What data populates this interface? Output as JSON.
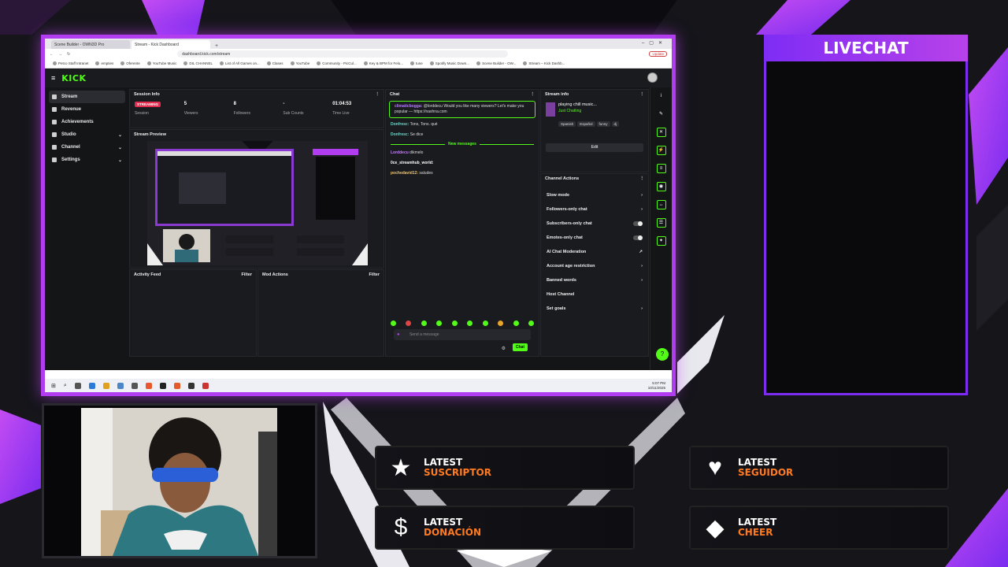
{
  "browser": {
    "tabs": [
      "Scene Builder - OWN3D Pro",
      "Stream - Kick Dashboard"
    ],
    "url": "dashboard.kick.com/stream",
    "update_label": "Update",
    "bookmarks": [
      "Petco Staff Intranet",
      "empties",
      "Oferente",
      "YouTube Music",
      "DIL CHANNEL",
      "List of All Games on...",
      "Clases",
      "YouTube",
      "Community - PicCul...",
      "Key & BPM for Felo...",
      "tune",
      "Spotify Music Down...",
      "Scene Builder - OW...",
      "Stream – Kick Dashb..."
    ]
  },
  "kick": {
    "logo": "KICK",
    "sidebar": [
      {
        "label": "Stream",
        "active": true,
        "chevron": false
      },
      {
        "label": "Revenue",
        "active": false,
        "chevron": false
      },
      {
        "label": "Achievements",
        "active": false,
        "chevron": false
      },
      {
        "label": "Studio",
        "active": false,
        "chevron": true
      },
      {
        "label": "Channel",
        "active": false,
        "chevron": true
      },
      {
        "label": "Settings",
        "active": false,
        "chevron": true
      }
    ],
    "session": {
      "title": "Session Info",
      "badge": "STREAMING",
      "stats": [
        {
          "value": "",
          "label": "Session"
        },
        {
          "value": "5",
          "label": "Viewers"
        },
        {
          "value": "8",
          "label": "Followers"
        },
        {
          "value": "-",
          "label": "Sub Counts"
        },
        {
          "value": "01:04:53",
          "label": "Time Live"
        }
      ]
    },
    "preview_title": "Stream Preview",
    "activity": {
      "title": "Activity Feed",
      "filter": "Filter"
    },
    "mod": {
      "title": "Mod Actions",
      "filter": "Filter"
    },
    "chat": {
      "title": "Chat",
      "pinned": {
        "user": "climaticbogga:",
        "text": "@lorddecu Would you like many viewers? Let's make you popular — https://nashna.com"
      },
      "messages_before": [
        {
          "user": "Donfresc:",
          "text": "Tons, Tons. qué"
        },
        {
          "user": "Donfresc:",
          "text": "Se dice"
        }
      ],
      "separator": "New messages",
      "messages_after": [
        {
          "user": "Lorddecu",
          "text": "dikmelo"
        },
        {
          "user": "0ce_streamhub_world:",
          "text": ""
        },
        {
          "user": "pochedavid12:",
          "text": "saludes"
        }
      ],
      "input_placeholder": "Send a message",
      "send_label": "Chat"
    },
    "stream_info": {
      "title": "Stream info",
      "stream_title": "playing chill music...",
      "category": "Just Chatting",
      "tags": [
        "Spanish",
        "Español",
        "funny",
        "dj"
      ],
      "edit_label": "Edit"
    },
    "channel_actions": {
      "title": "Channel Actions",
      "items": [
        {
          "label": "Slow mode",
          "control": "chevron"
        },
        {
          "label": "Followers-only chat",
          "control": "chevron"
        },
        {
          "label": "Subscribers-only chat",
          "control": "toggle"
        },
        {
          "label": "Emotes-only chat",
          "control": "toggle"
        },
        {
          "label": "AI Chat Moderation",
          "control": "link"
        },
        {
          "label": "Account age restriction",
          "control": "chevron"
        },
        {
          "label": "Banned words",
          "control": "chevron"
        },
        {
          "label": "Host Channel",
          "control": "none"
        },
        {
          "label": "Set goals",
          "control": "chevron"
        }
      ]
    }
  },
  "taskbar": {
    "time": "5:07 PM",
    "date": "10/11/2025"
  },
  "overlay": {
    "livechat_title": "LIVECHAT",
    "boxes": [
      {
        "line1": "LATEST",
        "line2": "SUSCRIPTOR",
        "icon": "star-icon"
      },
      {
        "line1": "LATEST",
        "line2": "SEGUIDOR",
        "icon": "heart-icon"
      },
      {
        "line1": "LATEST",
        "line2": "DONACIÓN",
        "icon": "dollar-icon"
      },
      {
        "line1": "LATEST",
        "line2": "CHEER",
        "icon": "diamond-icon"
      }
    ],
    "colors": {
      "accent": "#b23cf0",
      "highlight": "#ff7a20",
      "kick_green": "#53fc18"
    }
  }
}
